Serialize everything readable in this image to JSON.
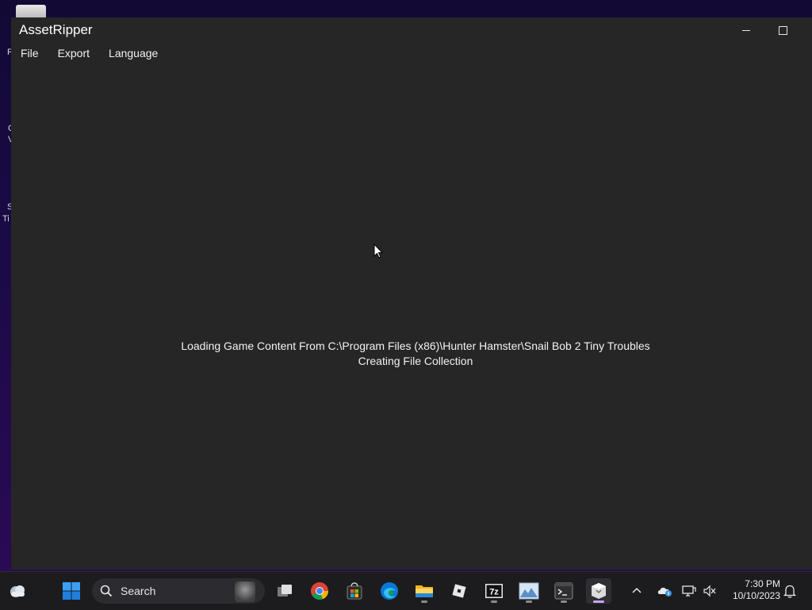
{
  "window": {
    "title": "AssetRipper",
    "menu": [
      "File",
      "Export",
      "Language"
    ]
  },
  "status": {
    "line1": "Loading Game Content From C:\\Program Files (x86)\\Hunter Hamster\\Snail Bob 2 Tiny Troubles",
    "line2": "Creating File Collection"
  },
  "taskbar": {
    "search_label": "Search",
    "time": "7:30 PM",
    "date": "10/10/2023",
    "pinned": [
      "widgets-icon",
      "start-icon",
      "task-view-icon",
      "chrome-icon",
      "store-icon",
      "edge-icon",
      "file-explorer-icon",
      "roblox-icon",
      "7zip-icon",
      "image-viewer-icon",
      "terminal-icon",
      "assetripper-icon"
    ]
  },
  "colors": {
    "window_bg": "#262626",
    "taskbar_bg": "#1c1c1f",
    "accent": "#c9a4ff"
  }
}
